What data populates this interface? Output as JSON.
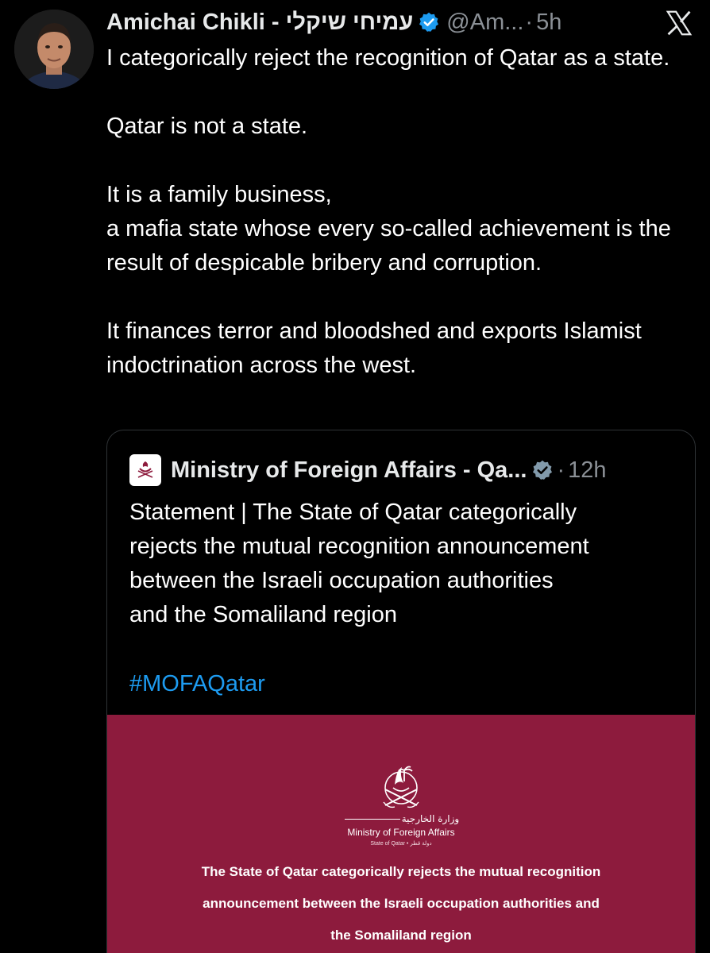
{
  "post": {
    "author_name": "Amichai Chikli - עמיחי שיקלי",
    "handle": "@Am...",
    "separator": "·",
    "time": "5h",
    "paragraphs": [
      "I categorically reject the recognition of Qatar as a state.",
      "Qatar is not a state.",
      "It is a family business,\na mafia state whose every so-called achievement is the result of despicable bribery and corruption.",
      "It finances terror and bloodshed and exports Islamist indoctrination across the west."
    ]
  },
  "quoted": {
    "author_name": "Ministry of Foreign Affairs - Qa...",
    "separator": "·",
    "time": "12h",
    "text_lines": [
      "Statement | The State of Qatar categorically",
      "rejects the mutual recognition announcement",
      "between the Israeli occupation authorities",
      "and the Somaliland region"
    ],
    "hashtag": "#MOFAQatar",
    "media": {
      "arabic_name": "وزارة الخارجية",
      "english_name": "Ministry of Foreign Affairs",
      "subtitle": "State of Qatar • دولة قطر",
      "headline_lines": [
        "The State of Qatar categorically rejects the mutual recognition",
        "announcement between the Israeli occupation authorities and",
        "the Somaliland region"
      ]
    }
  },
  "colors": {
    "background": "#000000",
    "text": "#ffffff",
    "muted": "#8b9096",
    "link": "#1d9bf0",
    "verified": "#1d9bf0",
    "media_bg": "#8d1b3d"
  },
  "icons": {
    "verified": "verified-badge-icon",
    "platform": "x-logo-icon",
    "emblem": "qatar-emblem-icon"
  }
}
